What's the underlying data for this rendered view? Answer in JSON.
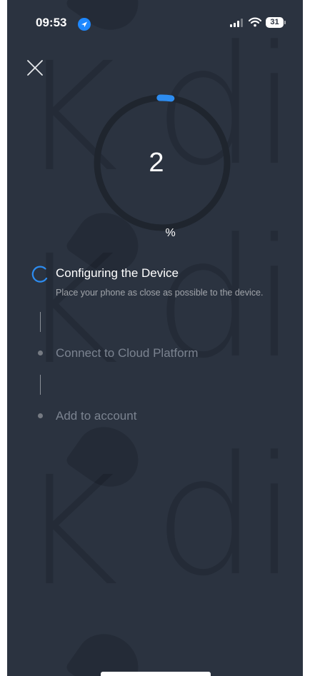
{
  "status_bar": {
    "time": "09:53",
    "battery": "31",
    "icons": [
      "location-arrow-icon",
      "cellular-signal-icon",
      "wifi-icon",
      "battery-icon"
    ]
  },
  "progress": {
    "value": "2",
    "unit": "%",
    "fraction": 0.02
  },
  "steps": [
    {
      "label": "Configuring the Device",
      "hint": "Place your phone as close as possible to the device.",
      "state": "in-progress"
    },
    {
      "label": "Connect to Cloud Platform",
      "state": "pending"
    },
    {
      "label": "Add to account",
      "state": "pending"
    }
  ],
  "watermark": {
    "text_k": "K",
    "text_dig": "dig"
  },
  "colors": {
    "background": "#2b3340",
    "accent": "#2d8cf0",
    "ring_track": "#1f252e",
    "text_primary": "#ffffff",
    "text_muted": "#7b8390"
  }
}
